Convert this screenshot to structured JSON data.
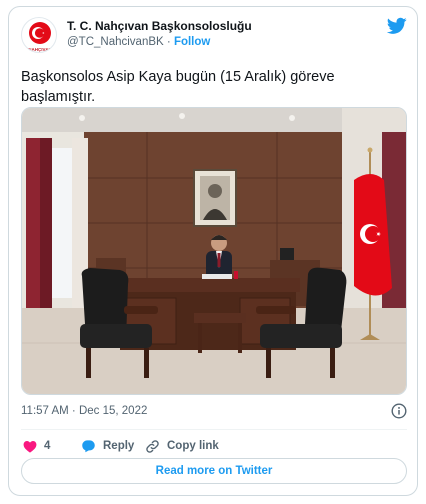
{
  "tweet": {
    "author_name": "T. C. Nahçıvan Başkonsolosluğu",
    "handle": "@TC_NahcivanBK",
    "separator": "·",
    "follow_label": "Follow",
    "avatar_caption": "NAHÇIVAN",
    "text_line1": "Başkonsolos Asip Kaya bugün (15 Aralık) göreve",
    "text_line2": "başlamıştır.",
    "timestamp": "11:57 AM · Dec 15, 2022",
    "like_count": "4",
    "reply_label": "Reply",
    "copy_link_label": "Copy link",
    "read_more_label": "Read more on Twitter"
  },
  "icons": {
    "brand": "twitter-bird-icon",
    "info": "info-icon",
    "like": "heart-icon",
    "reply": "reply-bubble-icon",
    "copy": "link-icon"
  },
  "colors": {
    "accent": "#1d9bf0",
    "like": "#f91880",
    "muted": "#536471",
    "border": "#cfd9de",
    "flag_red": "#e30a17"
  }
}
